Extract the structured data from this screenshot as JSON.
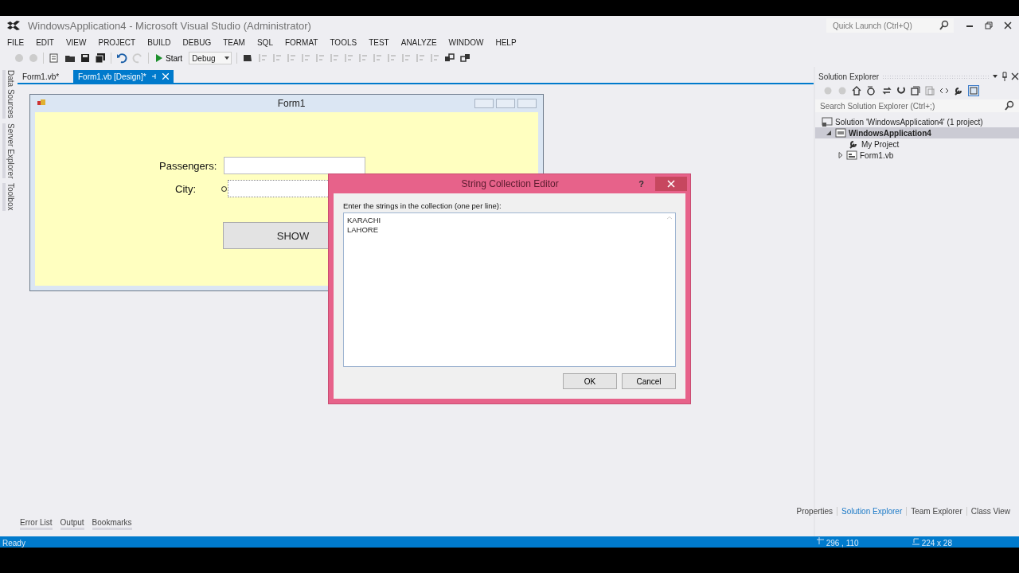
{
  "window": {
    "title": "WindowsApplication4 - Microsoft Visual Studio (Administrator)"
  },
  "quick_launch": {
    "placeholder": "Quick Launch (Ctrl+Q)"
  },
  "menu": [
    "FILE",
    "EDIT",
    "VIEW",
    "PROJECT",
    "BUILD",
    "DEBUG",
    "TEAM",
    "SQL",
    "FORMAT",
    "TOOLS",
    "TEST",
    "ANALYZE",
    "WINDOW",
    "HELP"
  ],
  "toolbar": {
    "start": "Start",
    "configuration": "Debug"
  },
  "side_tabs": [
    "Data Sources",
    "Server Explorer",
    "Toolbox"
  ],
  "doc_tabs": [
    {
      "label": "Form1.vb*",
      "selected": false
    },
    {
      "label": "Form1.vb [Design]*",
      "selected": true
    }
  ],
  "form": {
    "title": "Form1",
    "fields": [
      {
        "label": "Passengers:"
      },
      {
        "label": "City:"
      }
    ],
    "button": "SHOW"
  },
  "dialog": {
    "title": "String Collection Editor",
    "help": "?",
    "prompt": "Enter the strings in the collection (one per line):",
    "lines": [
      "KARACHI",
      "LAHORE"
    ],
    "buttons": [
      "OK",
      "Cancel"
    ]
  },
  "bottom_tabs": [
    "Error List",
    "Output",
    "Bookmarks"
  ],
  "solution_explorer": {
    "title": "Solution Explorer",
    "search": {
      "placeholder": "Search Solution Explorer (Ctrl+;)"
    },
    "tree": [
      {
        "label": "Solution 'WindowsApplication4' (1 project)",
        "kind": "solution",
        "selected": false,
        "children": [
          {
            "label": "WindowsApplication4",
            "kind": "project",
            "selected": true,
            "expanded": true,
            "children": [
              {
                "label": "My Project",
                "kind": "properties",
                "selected": false
              },
              {
                "label": "Form1.vb",
                "kind": "form",
                "selected": false,
                "expanded": false
              }
            ]
          }
        ]
      }
    ]
  },
  "panel_tabs": [
    {
      "label": "Properties",
      "selected": false
    },
    {
      "label": "Solution Explorer",
      "selected": true
    },
    {
      "label": "Team Explorer",
      "selected": false
    },
    {
      "label": "Class View",
      "selected": false
    }
  ],
  "status_bar": {
    "text": "Ready",
    "position": "296 , 110",
    "size": "224 x 28"
  }
}
